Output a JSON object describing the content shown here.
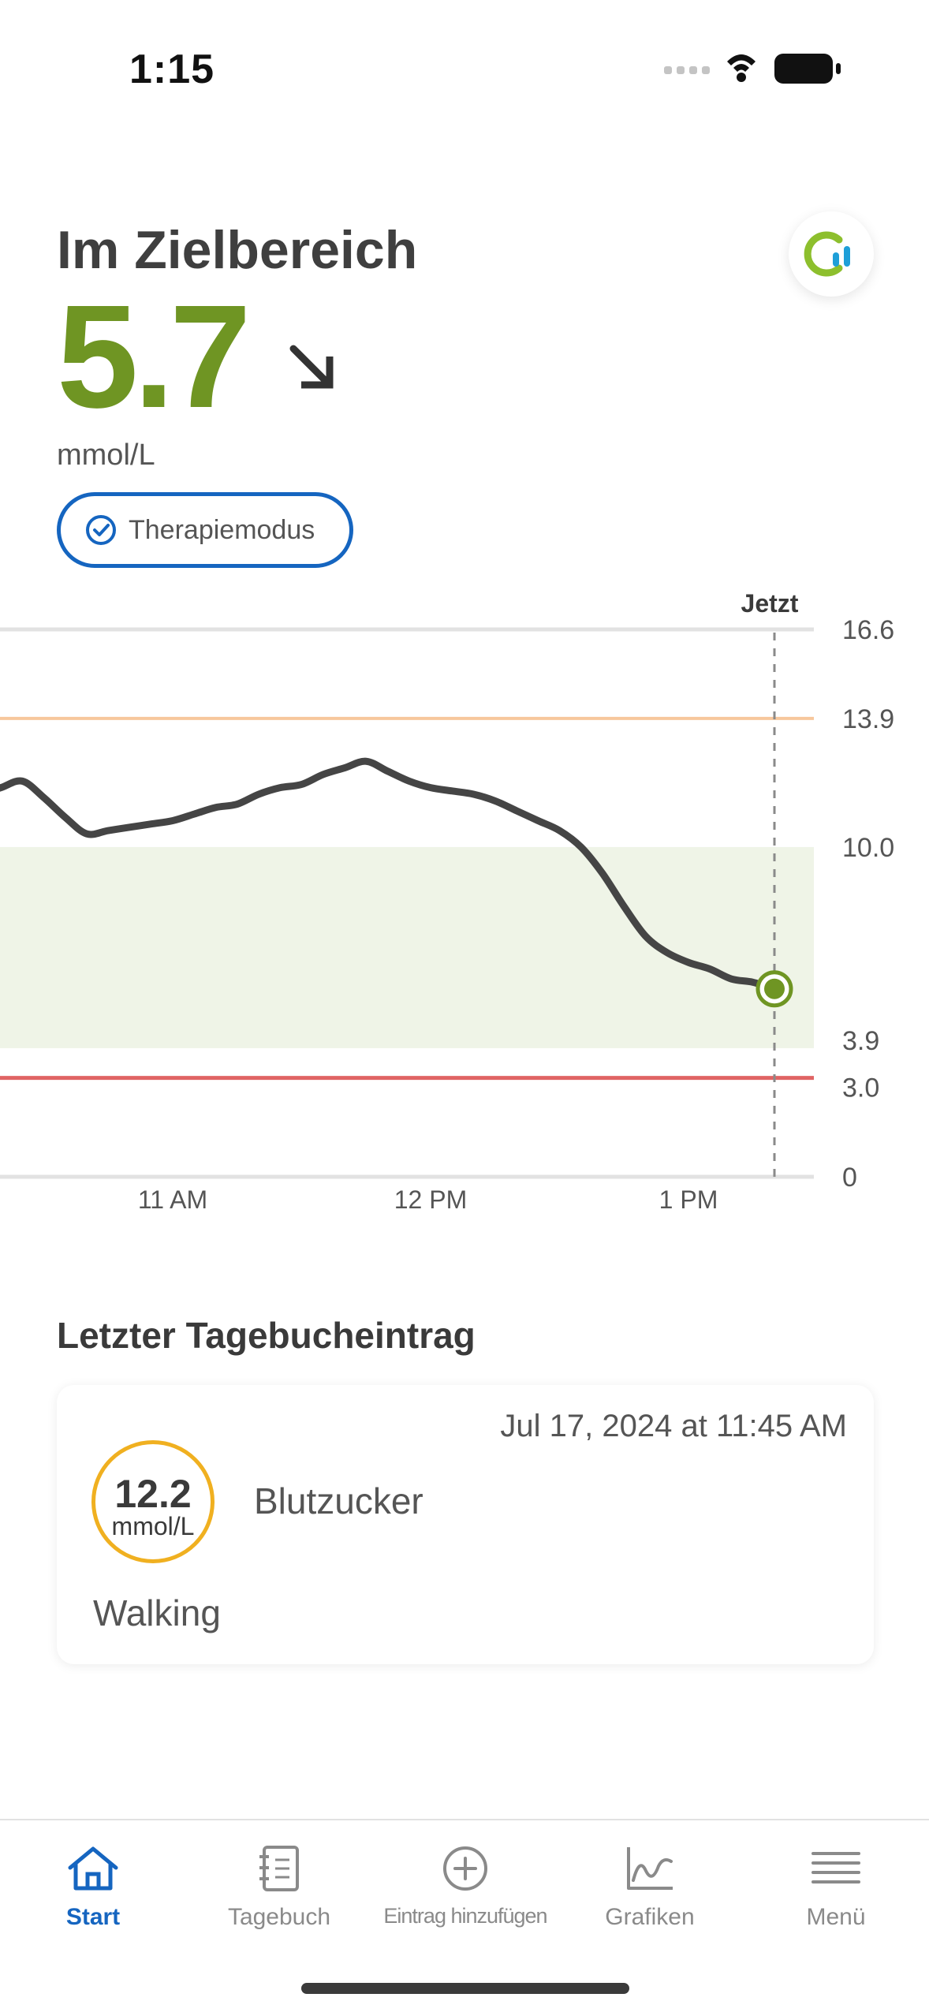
{
  "status_bar": {
    "time": "1:15"
  },
  "header": {
    "status_title": "Im Zielbereich",
    "glucose_value": "5.7",
    "glucose_unit": "mmol/L",
    "trend": "arrow-down-right-icon",
    "therapy_mode_label": "Therapiemodus"
  },
  "chart_data": {
    "type": "line",
    "now_label": "Jetzt",
    "y_ticks": [
      "16.6",
      "13.9",
      "10.0",
      "3.9",
      "3.0",
      "0"
    ],
    "x_ticks": [
      "11 AM",
      "12 PM",
      "1 PM"
    ],
    "ylim": [
      0,
      16.6
    ],
    "target_range": [
      3.9,
      10.0
    ],
    "high_threshold": 13.9,
    "low_threshold": 3.0,
    "series": [
      {
        "x": [
          "10:15",
          "10:20",
          "10:25",
          "10:30",
          "10:35",
          "10:40",
          "10:45",
          "10:50",
          "10:55",
          "11:00",
          "11:05",
          "11:10",
          "11:15",
          "11:20",
          "11:25",
          "11:30",
          "11:35",
          "11:40",
          "11:45",
          "11:50",
          "11:55",
          "12:00",
          "12:05",
          "12:10",
          "12:15",
          "12:20",
          "12:25",
          "12:30",
          "12:35",
          "12:40",
          "12:45",
          "12:50",
          "12:55",
          "13:00",
          "13:05",
          "13:10",
          "13:15",
          "13:20"
        ],
        "values": [
          11.6,
          11.8,
          12.0,
          11.5,
          10.9,
          10.4,
          10.5,
          10.6,
          10.7,
          10.8,
          11.0,
          11.2,
          11.3,
          11.6,
          11.8,
          11.9,
          12.2,
          12.4,
          12.6,
          12.3,
          12.0,
          11.8,
          11.7,
          11.6,
          11.4,
          11.1,
          10.8,
          10.5,
          10.0,
          9.2,
          8.2,
          7.3,
          6.8,
          6.5,
          6.3,
          6.0,
          5.9,
          5.7
        ]
      }
    ],
    "colors": {
      "line": "#454545",
      "current_point": "#6f9523",
      "target_band": "#eff4e7",
      "high_line": "#f7c79c",
      "low_line": "#e06464"
    }
  },
  "diary": {
    "title": "Letzter Tagebucheintrag",
    "entry": {
      "date": "Jul 17, 2024 at 11:45 AM",
      "value": "12.2",
      "unit": "mmol/L",
      "type": "Blutzucker",
      "note": "Walking",
      "badge_color": "#f0b020"
    }
  },
  "tab_bar": {
    "items": [
      {
        "label": "Start",
        "icon": "home-icon",
        "active": true
      },
      {
        "label": "Tagebuch",
        "icon": "notebook-icon",
        "active": false
      },
      {
        "label": "Eintrag hinzufügen",
        "icon": "add-circle-icon",
        "active": false
      },
      {
        "label": "Grafiken",
        "icon": "chart-icon",
        "active": false
      },
      {
        "label": "Menü",
        "icon": "menu-icon",
        "active": false
      }
    ],
    "active_color": "#1565c0"
  },
  "colors": {
    "accent": "#1565c0",
    "in_range": "#6f9523"
  }
}
